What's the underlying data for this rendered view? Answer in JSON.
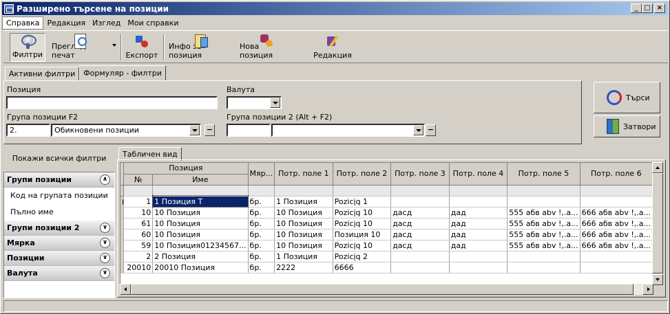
{
  "window": {
    "title": "Разширено търсене на позиции"
  },
  "menu": [
    "Справка",
    "Редакция",
    "Изглед",
    "Мои справки"
  ],
  "toolbar": {
    "filters": "Филтри",
    "preview": "Преглед печат",
    "export": "Експорт",
    "info": "Инфо за позиция",
    "new": "Нова позиция",
    "edit": "Редакция"
  },
  "filter_tabs": [
    "Активни филтри",
    "Формуляр - филтри"
  ],
  "form": {
    "position_label": "Позиция",
    "position_value": "",
    "currency_label": "Валута",
    "currency_value": "",
    "group_label": "Група позиции  F2",
    "group_code": "2.",
    "group_name": "Обикновени позиции",
    "group2_label": "Група позиции 2 (Alt + F2)",
    "group2_code": "",
    "group2_name": ""
  },
  "buttons": {
    "search": "Търси",
    "close": "Затвори"
  },
  "left": {
    "show_all": "Покажи всички филтри",
    "groups": [
      {
        "title": "Групи позиции",
        "expanded": true,
        "items": [
          "Код на групата позиции",
          "Пълно име"
        ]
      },
      {
        "title": "Групи позиции 2",
        "expanded": false,
        "items": []
      },
      {
        "title": "Мярка",
        "expanded": false,
        "items": []
      },
      {
        "title": "Позиции",
        "expanded": false,
        "items": []
      },
      {
        "title": "Валута",
        "expanded": false,
        "items": []
      }
    ]
  },
  "grid": {
    "tab": "Табличен вид",
    "band": "Позиция",
    "headers": [
      "№",
      "Име",
      "Мяр...",
      "Потр. поле 1",
      "Потр. поле 2",
      "Потр. поле 3",
      "Потр. поле 4",
      "Потр. поле 5",
      "Потр. поле 6"
    ],
    "rows": [
      [
        "1",
        "1 Позиция T",
        "бр.",
        "1 Позиция",
        "Pozicįq 1",
        "",
        "",
        "",
        ""
      ],
      [
        "10",
        "10 Позиция",
        "бр.",
        "10 Позиция",
        "Pozicįq 10",
        "дасд",
        "дад",
        "555 абв abv !,.a...",
        "666 абв abv !,.a..."
      ],
      [
        "61",
        "10 Позиция",
        "бр.",
        "10 Позиция",
        "Pozicįq 10",
        "дасд",
        "дад",
        "555 абв abv !,.a...",
        "666 абв abv !,.a..."
      ],
      [
        "60",
        "10 Позиция",
        "бр.",
        "10 Позиция",
        "Позиция 10",
        "дасд",
        "дад",
        "555 абв abv !,.a...",
        "666 абв abv !,.a..."
      ],
      [
        "59",
        "10 Позиция01234567...",
        "бр.",
        "10 Позиция",
        "Pozicįq 10",
        "дасд",
        "дад",
        "555 абв abv !,.a...",
        "666 абв abv !,.a..."
      ],
      [
        "2",
        "2 Позиция",
        "бр.",
        "1 Позиция",
        "Pozicįq 2",
        "",
        "",
        "",
        ""
      ],
      [
        "20010",
        "20010 Позиция",
        "бр.",
        "2222",
        "6666",
        "",
        "",
        "",
        ""
      ]
    ]
  }
}
